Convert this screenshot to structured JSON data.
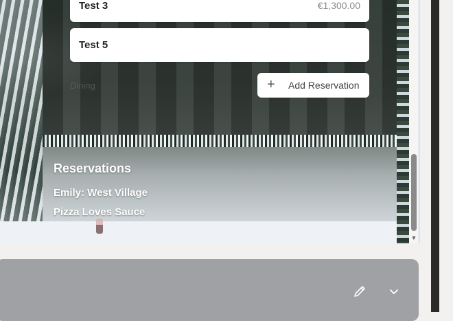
{
  "reservation_items": [
    {
      "name": "Test 3",
      "price": "€1,300.00"
    },
    {
      "name": "Test 5",
      "price": ""
    }
  ],
  "section_label": "Dining",
  "add_button": {
    "label": "Add Reservation",
    "icon": "plus-icon"
  },
  "reservations": {
    "title": "Reservations",
    "items": [
      "Emily: West Village",
      "Pizza Loves Sauce"
    ]
  },
  "toolbar": {
    "edit_icon": "pencil-icon",
    "expand_icon": "chevron-down-icon"
  },
  "colors": {
    "toolbar_bg": "#a0a1a4",
    "card_bg": "#ffffff",
    "scroll_thumb": "#8a8a8a"
  }
}
